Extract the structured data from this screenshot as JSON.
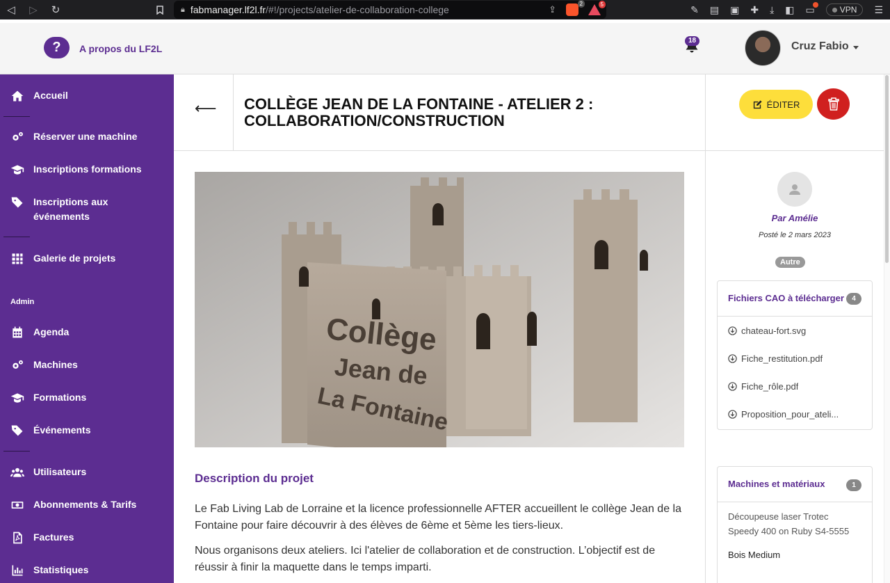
{
  "browser": {
    "url_host": "fabmanager.lf2l.fr",
    "url_path": "/#!/projects/atelier-de-collaboration-college",
    "brave_badge": "2",
    "rewards_badge": "5",
    "vpn_label": "VPN"
  },
  "header": {
    "help_symbol": "?",
    "about_label": "A propos du LF2L",
    "notification_count": "18",
    "user_name": "Cruz Fabio"
  },
  "sidebar": {
    "items": [
      {
        "label": "Accueil",
        "icon": "home-icon"
      },
      {
        "label": "Réserver une machine",
        "icon": "cogs-icon"
      },
      {
        "label": "Inscriptions formations",
        "icon": "graduation-cap-icon"
      },
      {
        "label": "Inscriptions aux événements",
        "icon": "tags-icon"
      },
      {
        "label": "Galerie de projets",
        "icon": "grid-icon"
      }
    ],
    "admin_label": "Admin",
    "admin_items": [
      {
        "label": "Agenda",
        "icon": "calendar-icon"
      },
      {
        "label": "Machines",
        "icon": "cogs-icon"
      },
      {
        "label": "Formations",
        "icon": "graduation-cap-icon"
      },
      {
        "label": "Événements",
        "icon": "tags-icon"
      },
      {
        "label": "Utilisateurs",
        "icon": "users-icon"
      },
      {
        "label": "Abonnements & Tarifs",
        "icon": "money-icon"
      },
      {
        "label": "Factures",
        "icon": "file-pdf-icon"
      },
      {
        "label": "Statistiques",
        "icon": "bar-chart-icon"
      }
    ]
  },
  "project": {
    "title": "Collège Jean de la Fontaine - Atelier 2 : collaboration/construction",
    "image_text_line1": "Collège",
    "image_text_line2": "Jean de",
    "image_text_line3": "La Fontaine",
    "description_heading": "Description du projet",
    "description_p1": "Le Fab Living Lab de Lorraine et la licence professionnelle AFTER accueillent le collège Jean de la Fontaine pour faire découvrir à des élèves de 6ème et 5ème les tiers-lieux.",
    "description_p2": "Nous organisons deux ateliers. Ici l'atelier de collaboration et de construction. L’objectif est de réussir à finir la maquette dans le temps imparti."
  },
  "actions": {
    "edit_label": "ÉDITER"
  },
  "meta": {
    "author": "Par Amélie",
    "posted": "Posté le 2 mars 2023",
    "tag": "Autre"
  },
  "cad_files": {
    "title": "Fichiers CAO à télécharger",
    "count": "4",
    "files": [
      "chateau-fort.svg",
      "Fiche_restitution.pdf",
      "Fiche_rôle.pdf",
      "Proposition_pour_ateli..."
    ]
  },
  "machines": {
    "title": "Machines et matériaux",
    "count": "1",
    "machine": "Découpeuse laser Trotec Speedy 400 on Ruby S4-5555",
    "material": "Bois Medium"
  },
  "colors": {
    "brand_purple": "#5c2d91",
    "edit_yellow": "#fdde3b",
    "delete_red": "#d0201f"
  }
}
